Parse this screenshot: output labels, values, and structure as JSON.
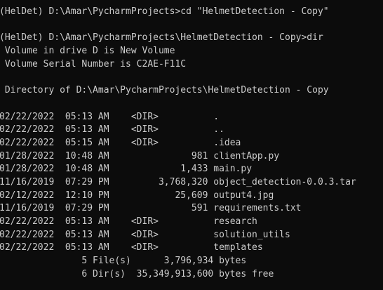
{
  "terminal": {
    "lines": [
      "(HelDet) D:\\Amar\\PycharmProjects>cd \"HelmetDetection - Copy\"",
      "",
      "(HelDet) D:\\Amar\\PycharmProjects\\HelmetDetection - Copy>dir",
      " Volume in drive D is New Volume",
      " Volume Serial Number is C2AE-F11C",
      "",
      " Directory of D:\\Amar\\PycharmProjects\\HelmetDetection - Copy",
      "",
      "02/22/2022  05:13 AM    <DIR>          .",
      "02/22/2022  05:13 AM    <DIR>          ..",
      "02/22/2022  05:15 AM    <DIR>          .idea",
      "01/28/2022  10:48 AM               981 clientApp.py",
      "01/28/2022  10:48 AM             1,433 main.py",
      "11/16/2019  07:29 PM         3,768,320 object_detection-0.0.3.tar",
      "02/12/2022  12:10 PM            25,609 output4.jpg",
      "11/16/2019  07:29 PM               591 requirements.txt",
      "02/22/2022  05:13 AM    <DIR>          research",
      "02/22/2022  05:13 AM    <DIR>          solution_utils",
      "02/22/2022  05:13 AM    <DIR>          templates",
      "               5 File(s)      3,796,934 bytes",
      "               6 Dir(s)  35,349,913,600 bytes free"
    ]
  }
}
